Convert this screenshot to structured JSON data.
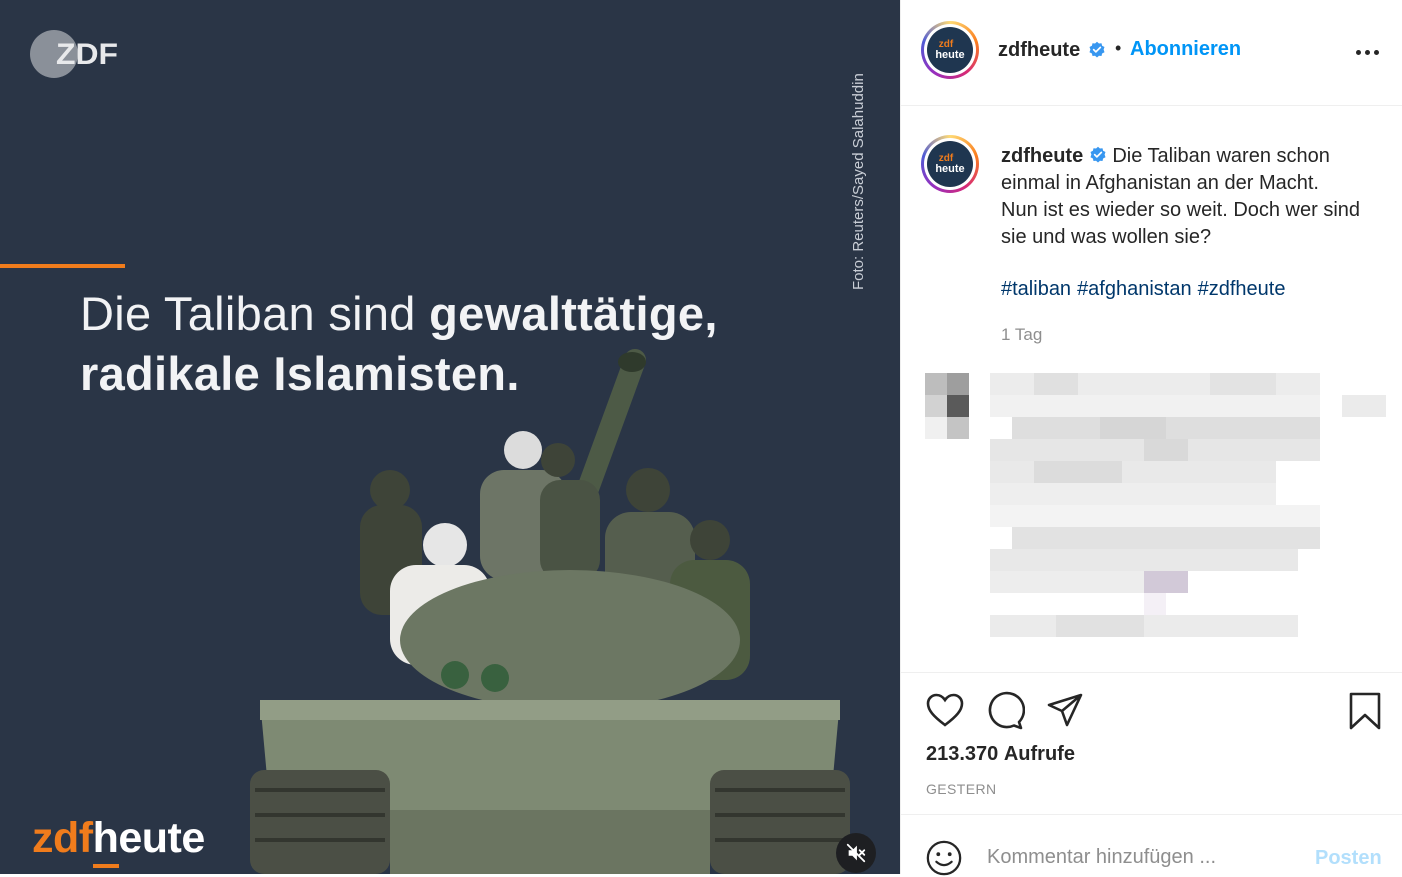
{
  "media": {
    "logo_text": "ZDF",
    "photo_credit": "Foto: Reuters/Sayed Salahuddin",
    "headline_regular": "Die Taliban sind ",
    "headline_bold_1": "gewalttätige,",
    "headline_bold_2": "radikale Islamisten.",
    "brand_zdf": "zdf",
    "brand_heute": "heute",
    "mute_icon": "speaker-muted-icon"
  },
  "header": {
    "avatar_line1": "zdf",
    "avatar_line2": "heute",
    "username": "zdfheute",
    "separator": "•",
    "follow_label": "Abonnieren",
    "more_icon": "more-horizontal-icon"
  },
  "caption": {
    "username": "zdfheute",
    "text": "Die Taliban waren schon einmal in Afghanistan an der Macht. Nun ist es wieder so weit. Doch wer sind sie und was wollen sie?",
    "hashtags": [
      "#taliban",
      "#afghanistan",
      "#zdfheute"
    ],
    "time_ago": "1 Tag"
  },
  "actions": {
    "icons": [
      "heart-icon",
      "comment-icon",
      "share-icon",
      "bookmark-icon"
    ],
    "views_count": "213.370",
    "views_label": "Aufrufe",
    "date_label": "GESTERN"
  },
  "comment_box": {
    "placeholder": "Kommentar hinzufügen ...",
    "post_label": "Posten"
  },
  "colors": {
    "accent_blue": "#0095f6",
    "hashtag": "#00376b",
    "zdf_orange": "#f07c1c",
    "media_bg": "#2a3546"
  }
}
